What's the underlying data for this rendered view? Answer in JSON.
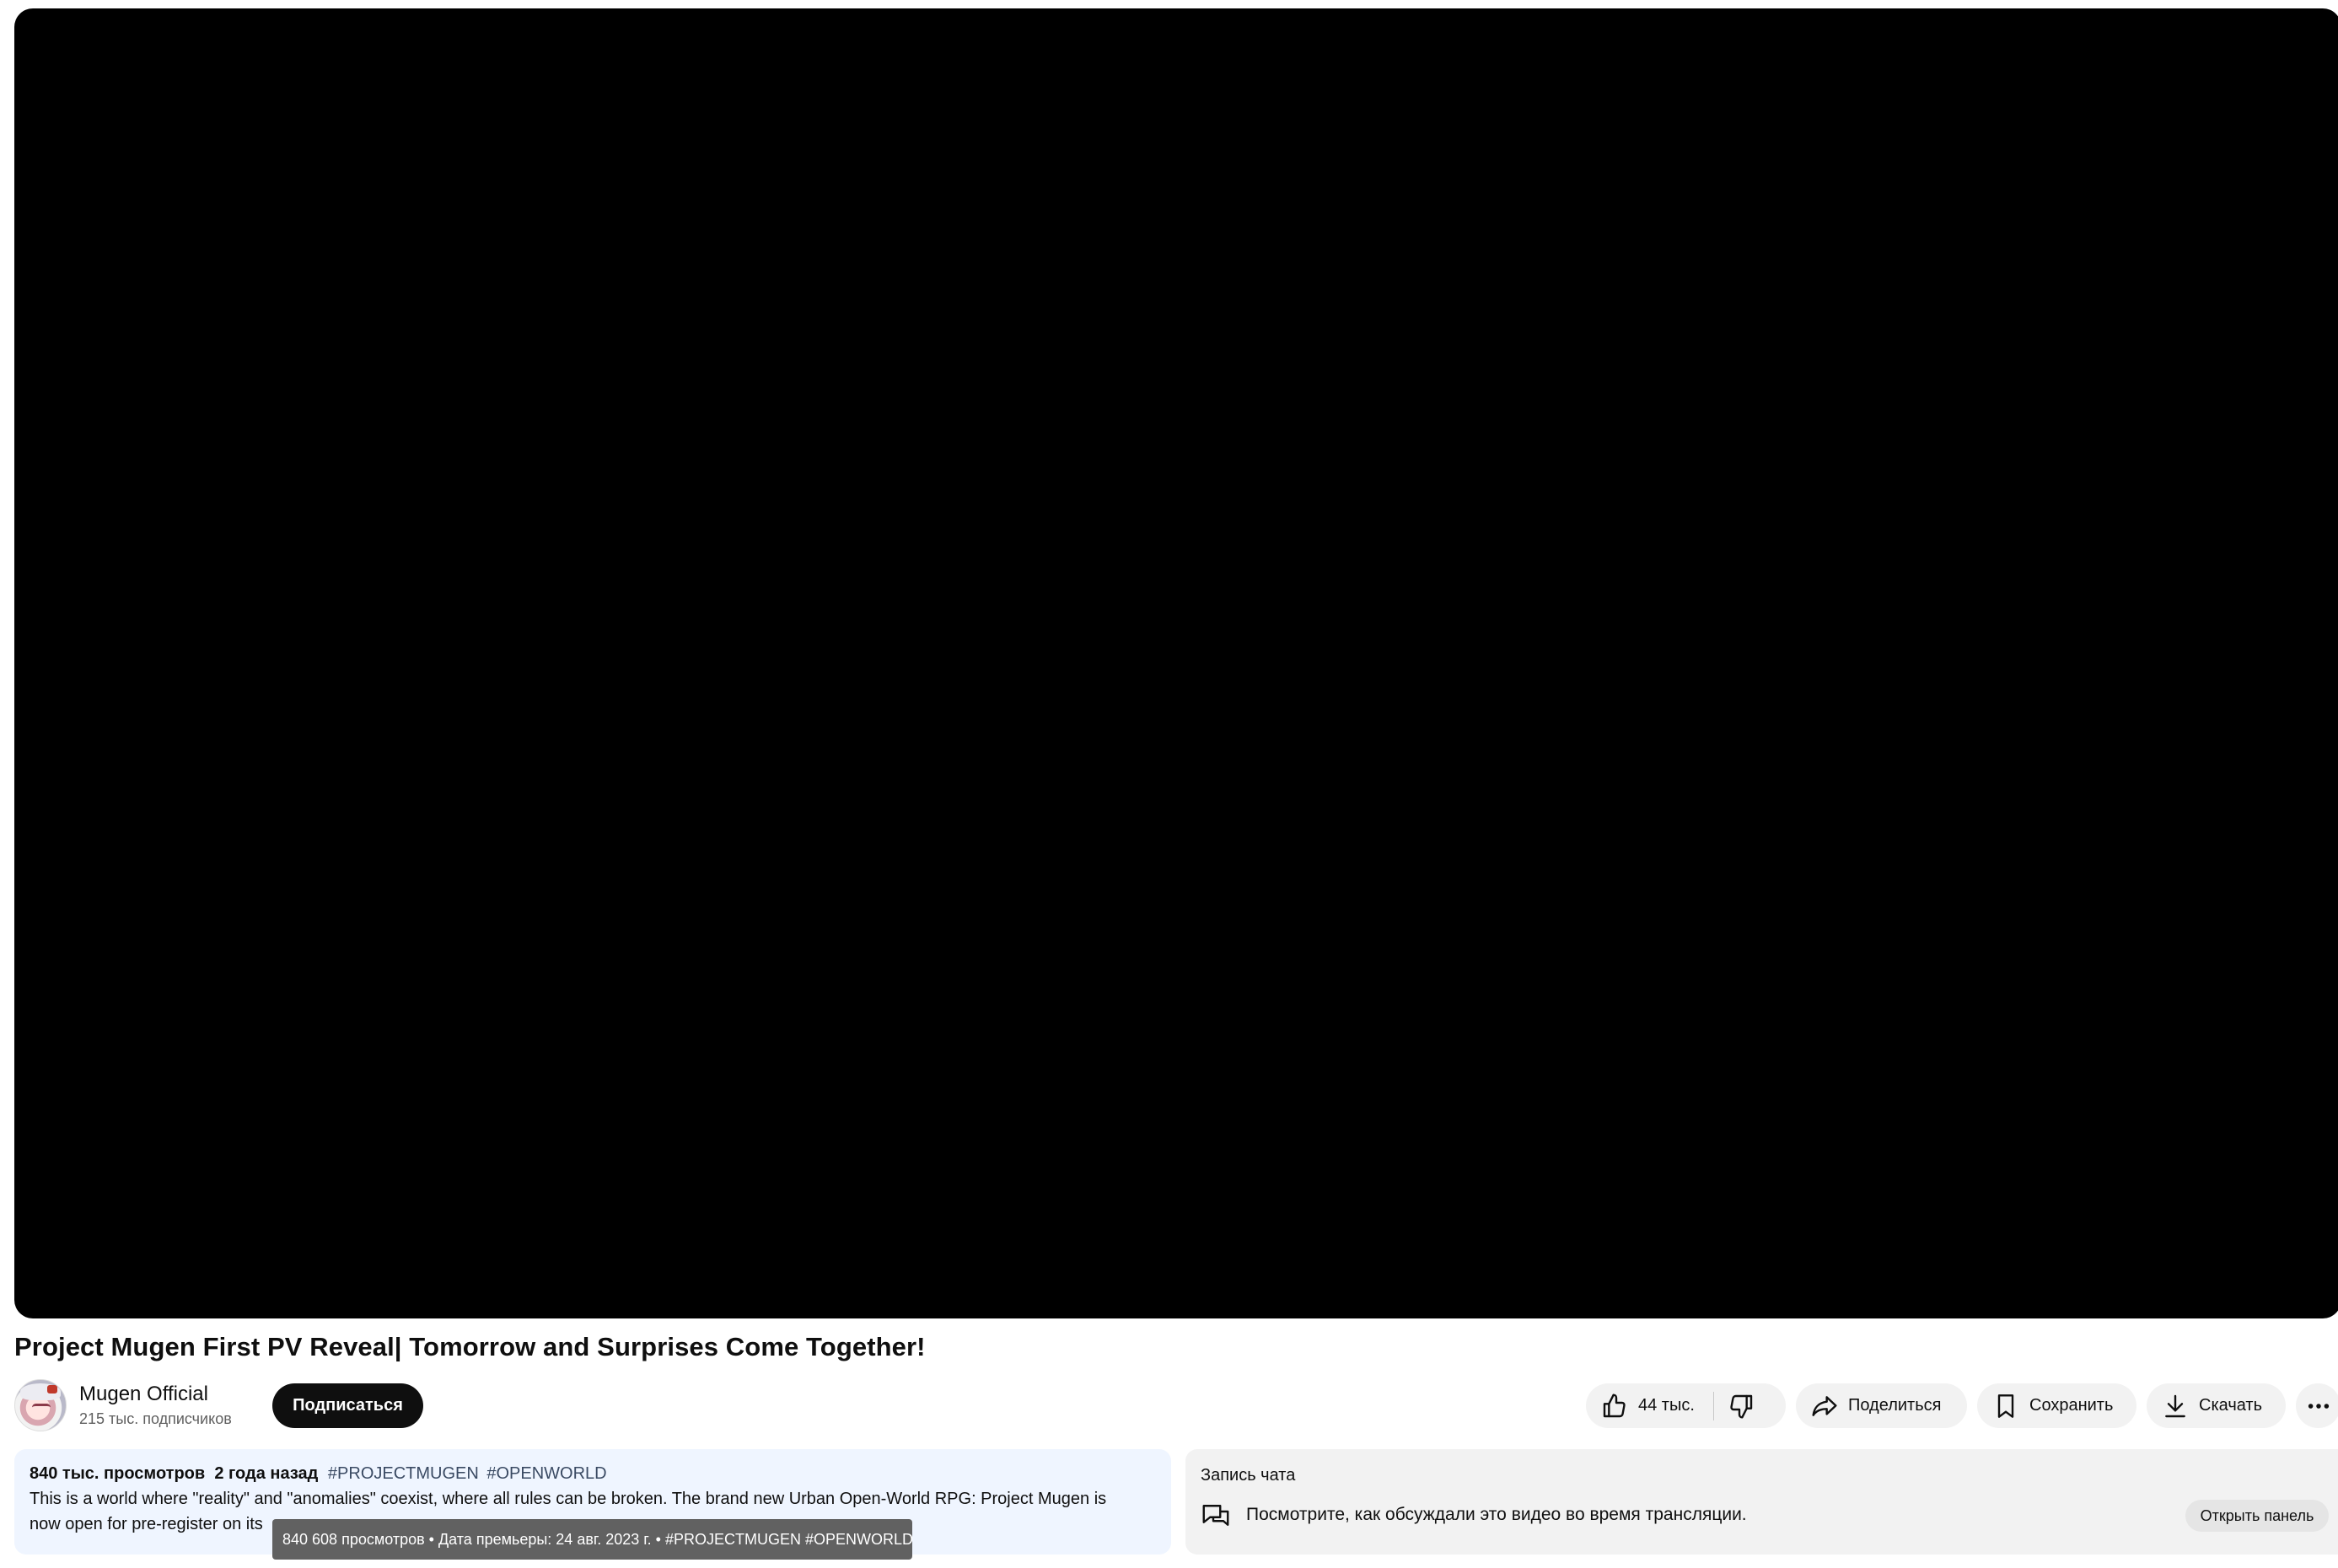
{
  "video": {
    "title": "Project Mugen First PV Reveal| Tomorrow and Surprises Come Together!"
  },
  "channel": {
    "name": "Mugen Official",
    "subscribers": "215 тыс. подписчиков",
    "subscribe_label": "Подписаться"
  },
  "actions": {
    "likes": "44 тыс.",
    "share_label": "Поделиться",
    "save_label": "Сохранить",
    "download_label": "Скачать"
  },
  "description": {
    "views": "840 тыс. просмотров",
    "date": "2 года назад",
    "tags": [
      "#PROJECTMUGEN",
      "#OPENWORLD"
    ],
    "line1": "This is a world where \"reality\" and \"anomalies\" coexist, where all rules can be broken. The brand new Urban Open-World RPG: Project Mugen is",
    "line2": "now open for pre-register on its"
  },
  "tooltip": {
    "text": "840 608 просмотров • Дата премьеры: 24 авг. 2023 г. • #PROJECTMUGEN #OPENWORLD"
  },
  "chat": {
    "heading": "Запись чата",
    "text": "Посмотрите, как обсуждали это видео во время трансляции.",
    "open_label": "Открыть панель"
  },
  "colors": {
    "description_bg": "#eff5ff",
    "pill_bg": "#f2f2f2",
    "subscribe_bg": "#0f0f0f",
    "tooltip_bg": "#616161",
    "hashtag": "#3a4a63"
  }
}
